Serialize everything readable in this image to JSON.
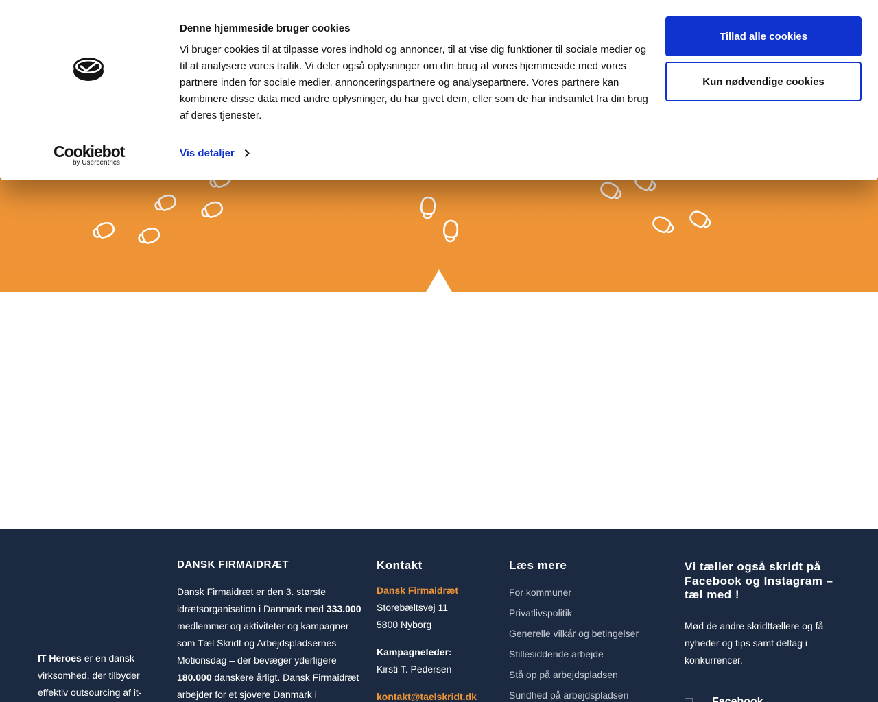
{
  "cookie_banner": {
    "title": "Denne hjemmeside bruger cookies",
    "body": "Vi bruger cookies til at tilpasse vores indhold og annoncer, til at vise dig funktioner til sociale medier og til at analysere vores trafik. Vi deler også oplysninger om din brug af vores hjemmeside med vores partnere inden for sociale medier, annonceringspartnere og analysepartnere. Vores partnere kan kombinere disse data med andre oplysninger, du har givet dem, eller som de har indsamlet fra din brug af deres tjenester.",
    "details_link": "Vis detaljer",
    "allow_all_button": "Tillad alle cookies",
    "necessary_button": "Kun nødvendige cookies",
    "brand_name": "Cookiebot",
    "brand_sub": "by Usercentrics",
    "accent_color": "#1032cf"
  },
  "hero": {
    "background_color": "#ef9537",
    "icon": "footprints-icon"
  },
  "footer": {
    "background_color": "#1b2a40",
    "about": {
      "company": "IT Heroes",
      "text": " er en dansk virksomhed, der tilbyder effektiv outsourcing af it-"
    },
    "dansk_firmaidraet": {
      "heading": "DANSK FIRMAIDRÆT",
      "text_1": "Dansk Firmaidræt er den 3. største idrætsorganisation i Danmark med ",
      "members": "333.000",
      "text_2": " medlemmer og aktiviteter og kampagner – som Tæl Skridt og Arbejdspladsernes Motionsdag – der bevæger yderligere ",
      "extra": "180.000",
      "text_3": " danskere årligt. Dansk Firmaidræt arbejder for et sjovere Danmark i"
    },
    "contact": {
      "heading": "Kontakt",
      "org": "Dansk Firmaidræt",
      "street": "Storebæltsvej 11",
      "city": "5800 Nyborg",
      "leader_label": "Kampagneleder:",
      "leader_name": "Kirsti T. Pedersen",
      "email": "kontakt@taelskridt.dk"
    },
    "read_more": {
      "heading": "Læs mere",
      "links": [
        "For kommuner",
        "Privatlivspolitik",
        "Generelle vilkår og betingelser",
        "Stillesiddende arbejde",
        "Stå op på arbejdspladsen",
        "Sundhed på arbejdspladsen"
      ]
    },
    "social": {
      "heading": "Vi tæller også skridt på Facebook og Instagram – tæl med !",
      "text": "Mød de andre skridttællere og få nyheder og tips samt deltag i konkurrencer.",
      "facebook_label": "Facebook"
    }
  }
}
